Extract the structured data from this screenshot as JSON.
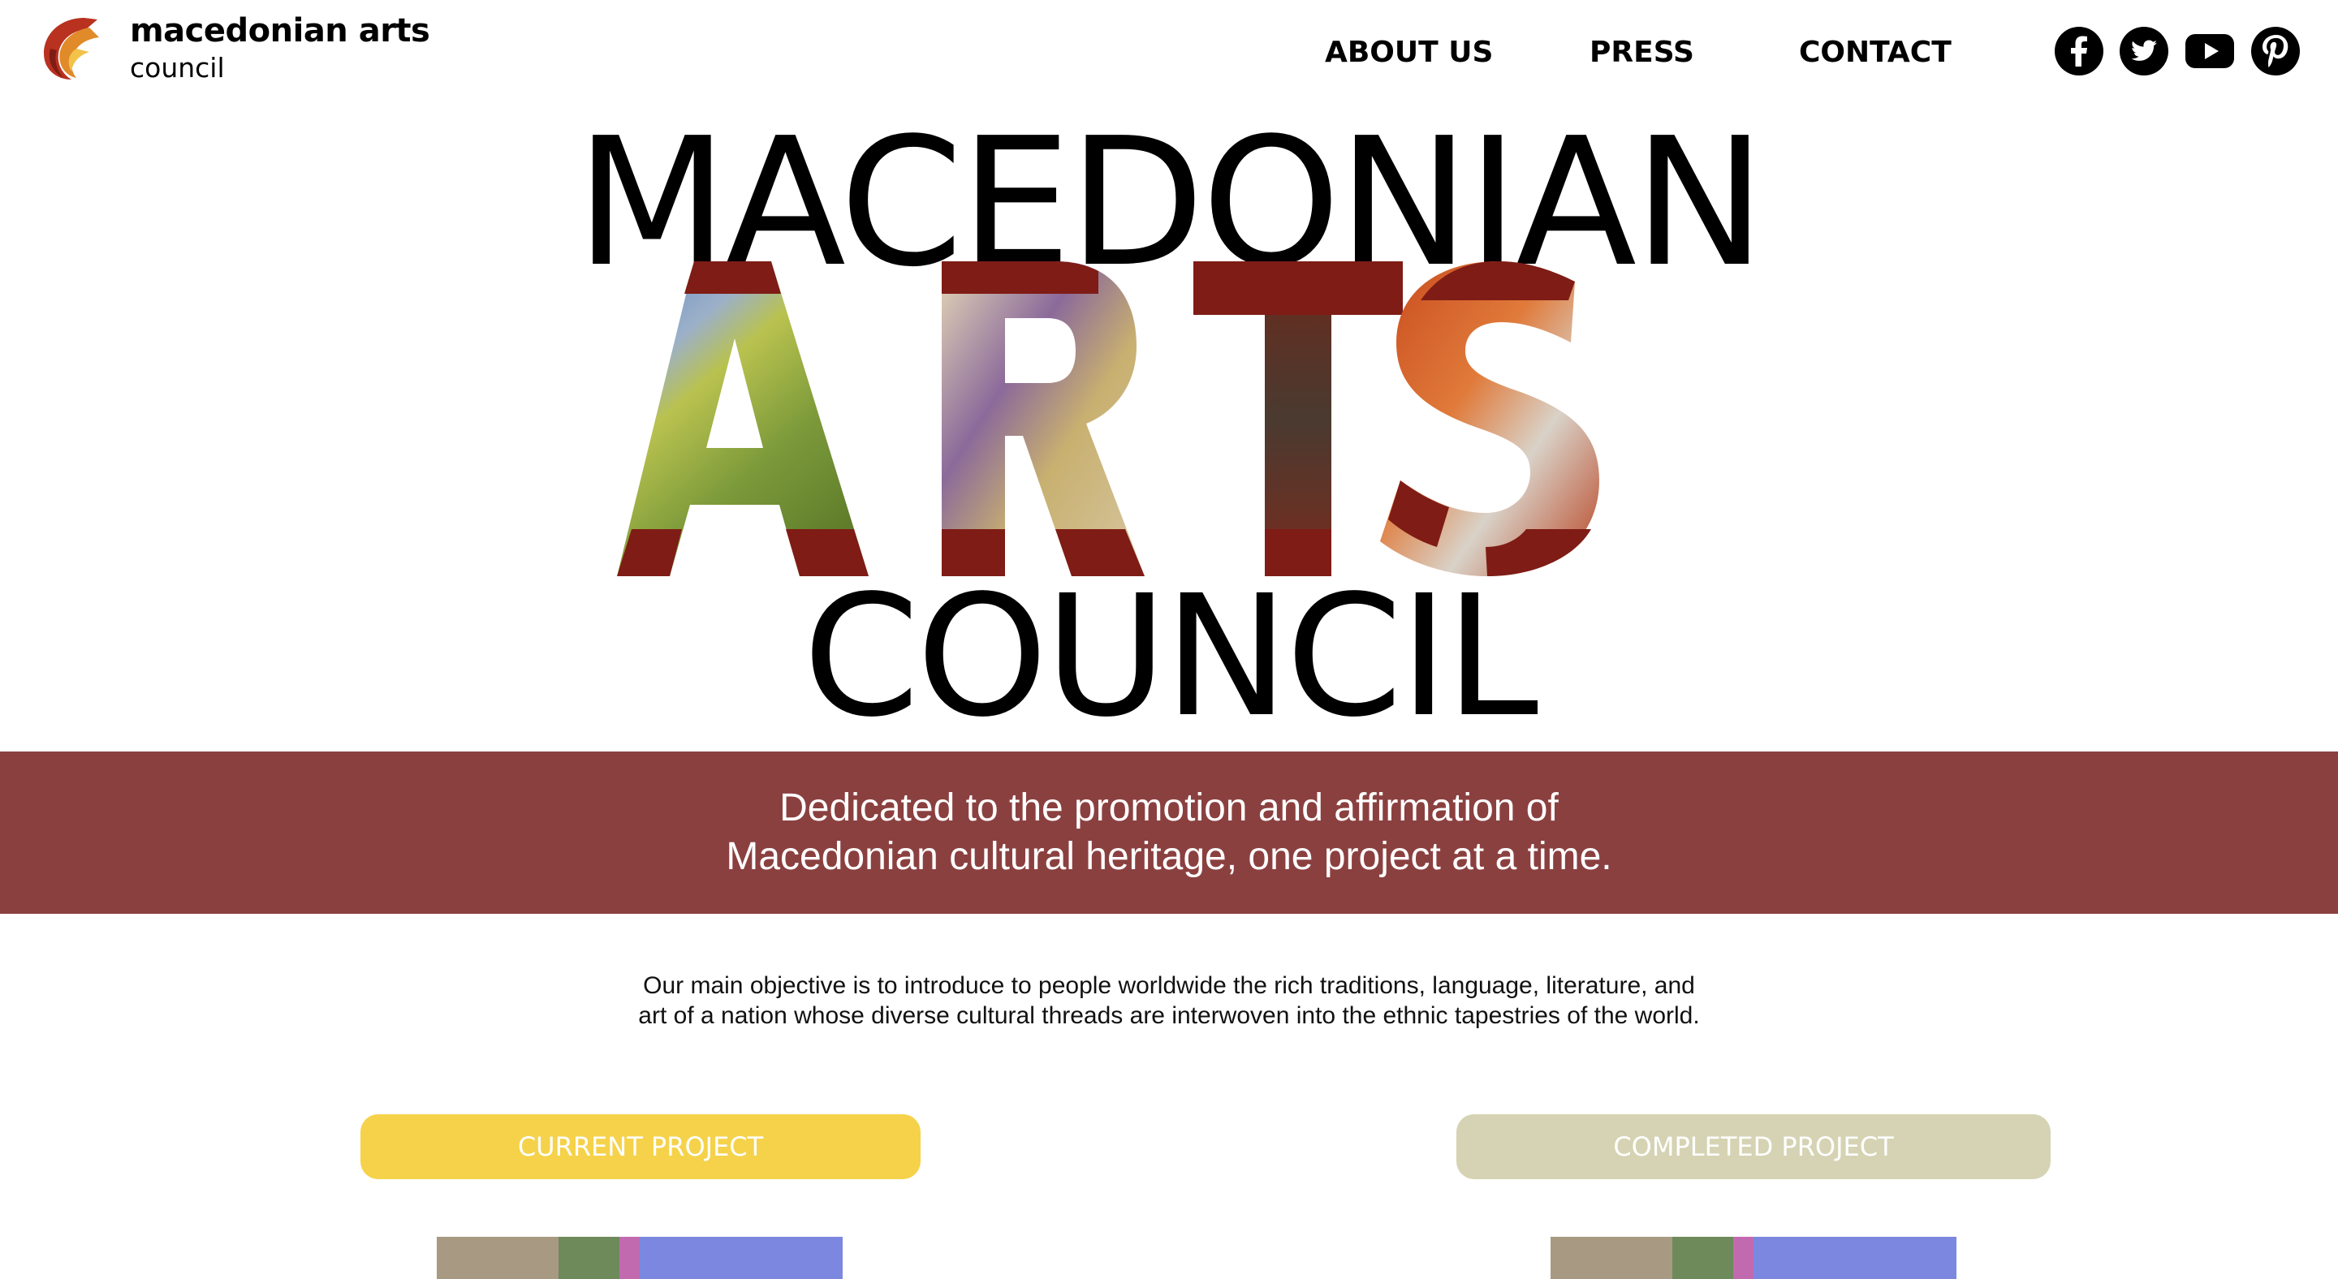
{
  "header": {
    "brand_line1": "macedonian arts",
    "brand_line2": "council",
    "nav": {
      "about": "ABOUT US",
      "press": "PRESS",
      "contact": "CONTACT"
    },
    "social_icons": [
      "facebook-icon",
      "twitter-icon",
      "youtube-icon",
      "pinterest-icon"
    ]
  },
  "hero": {
    "line1": "MACEDONIAN",
    "line2": "ARTS",
    "line3": "COUNCIL"
  },
  "banner": {
    "line1": "Dedicated to the promotion and affirmation of",
    "line2": "Macedonian cultural heritage, one project at a time."
  },
  "objective": {
    "line1": "Our main objective is to introduce to people worldwide the rich traditions, language, literature, and",
    "line2": "art of a nation whose diverse cultural threads are interwoven into the ethnic tapestries of the world."
  },
  "projects": {
    "current_label": "CURRENT PROJECT",
    "completed_label": "COMPLETED PROJECT"
  },
  "colors": {
    "banner": "#8b4040",
    "arts_red": "#7f1c16",
    "current_button": "#f5d24a",
    "completed_button": "#d5d3b3"
  }
}
